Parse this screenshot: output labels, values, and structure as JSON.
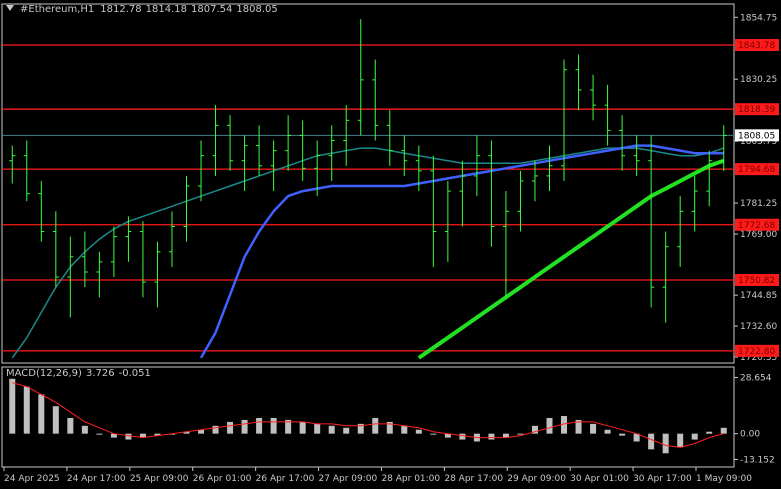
{
  "header": {
    "symbol": "#Ethereum,H1",
    "open": "1812.78",
    "high": "1814.18",
    "low": "1807.54",
    "close": "1808.05"
  },
  "macd_header": {
    "name": "MACD(12,26,9)",
    "main": "3.726",
    "signal": "-0.051"
  },
  "colors": {
    "background": "#000000",
    "grid_frame": "#c8c8c8",
    "candle": "#3cff3c",
    "level_line": "#ff1a1a",
    "level_label_bg": "#ff1a1a",
    "ma_fast": "#1a8a8a",
    "ma_mid": "#4060ff",
    "ma_slow": "#22e022",
    "price_line": "#4a7f8f",
    "histogram": "#c0c0c0",
    "signal_line": "#ff2020"
  },
  "chart_data": [
    {
      "type": "candlestick",
      "title": "#Ethereum,H1",
      "x_ticks": [
        "24 Apr 2025",
        "24 Apr 17:00",
        "25 Apr 09:00",
        "26 Apr 01:00",
        "26 Apr 17:00",
        "27 Apr 09:00",
        "28 Apr 01:00",
        "28 Apr 17:00",
        "29 Apr 09:00",
        "30 Apr 01:00",
        "30 Apr 17:00",
        "1 May 09:00"
      ],
      "y_ticks": [
        "1854.75",
        "1830.25",
        "1805.75",
        "1781.25",
        "1769.00",
        "1744.85",
        "1732.60",
        "1720.35"
      ],
      "ylim": [
        1718,
        1860
      ],
      "current_price": "1808.05",
      "levels": [
        "1843.78",
        "1818.39",
        "1794.68",
        "1772.68",
        "1750.82",
        "1722.80"
      ],
      "candles": [
        [
          1798,
          1804,
          1789,
          1800
        ],
        [
          1800,
          1806,
          1782,
          1785
        ],
        [
          1785,
          1790,
          1766,
          1770
        ],
        [
          1770,
          1778,
          1748,
          1752
        ],
        [
          1752,
          1768,
          1736,
          1760
        ],
        [
          1760,
          1770,
          1748,
          1754
        ],
        [
          1754,
          1762,
          1744,
          1758
        ],
        [
          1758,
          1772,
          1752,
          1768
        ],
        [
          1768,
          1776,
          1758,
          1770
        ],
        [
          1770,
          1774,
          1744,
          1750
        ],
        [
          1750,
          1766,
          1740,
          1762
        ],
        [
          1762,
          1778,
          1756,
          1772
        ],
        [
          1772,
          1792,
          1766,
          1788
        ],
        [
          1788,
          1806,
          1782,
          1800
        ],
        [
          1800,
          1820,
          1792,
          1812
        ],
        [
          1812,
          1816,
          1794,
          1798
        ],
        [
          1798,
          1808,
          1786,
          1804
        ],
        [
          1804,
          1812,
          1792,
          1796
        ],
        [
          1796,
          1806,
          1786,
          1802
        ],
        [
          1802,
          1816,
          1794,
          1808
        ],
        [
          1808,
          1814,
          1790,
          1795
        ],
        [
          1795,
          1806,
          1784,
          1800
        ],
        [
          1800,
          1812,
          1790,
          1806
        ],
        [
          1806,
          1820,
          1796,
          1814
        ],
        [
          1814,
          1854,
          1808,
          1830
        ],
        [
          1830,
          1838,
          1806,
          1812
        ],
        [
          1812,
          1818,
          1796,
          1802
        ],
        [
          1802,
          1808,
          1792,
          1798
        ],
        [
          1798,
          1804,
          1786,
          1794
        ],
        [
          1794,
          1800,
          1756,
          1770
        ],
        [
          1770,
          1790,
          1758,
          1786
        ],
        [
          1786,
          1798,
          1772,
          1792
        ],
        [
          1792,
          1808,
          1784,
          1800
        ],
        [
          1800,
          1806,
          1764,
          1772
        ],
        [
          1772,
          1786,
          1744,
          1778
        ],
        [
          1778,
          1794,
          1770,
          1790
        ],
        [
          1790,
          1798,
          1782,
          1792
        ],
        [
          1792,
          1804,
          1786,
          1796
        ],
        [
          1796,
          1838,
          1790,
          1834
        ],
        [
          1834,
          1840,
          1818,
          1826
        ],
        [
          1826,
          1832,
          1814,
          1820
        ],
        [
          1820,
          1828,
          1804,
          1810
        ],
        [
          1810,
          1816,
          1794,
          1800
        ],
        [
          1800,
          1808,
          1792,
          1798
        ],
        [
          1798,
          1808,
          1740,
          1748
        ],
        [
          1748,
          1770,
          1734,
          1764
        ],
        [
          1764,
          1784,
          1756,
          1778
        ],
        [
          1778,
          1792,
          1770,
          1786
        ],
        [
          1786,
          1802,
          1780,
          1798
        ],
        [
          1798,
          1812,
          1794,
          1808
        ]
      ],
      "ma_fast": [
        1720,
        1728,
        1738,
        1748,
        1756,
        1762,
        1767,
        1771,
        1774,
        1776,
        1778,
        1780,
        1782,
        1784,
        1786,
        1788,
        1790,
        1792,
        1794,
        1796,
        1798,
        1800,
        1801,
        1802,
        1803,
        1803,
        1802,
        1801,
        1800,
        1799,
        1798,
        1797,
        1797,
        1797,
        1797,
        1797,
        1798,
        1799,
        1800,
        1801,
        1802,
        1803,
        1803,
        1803,
        1802,
        1801,
        1800,
        1800,
        1801,
        1803
      ],
      "ma_mid": [
        null,
        null,
        null,
        null,
        null,
        null,
        null,
        null,
        null,
        null,
        null,
        null,
        null,
        1720,
        1730,
        1745,
        1760,
        1770,
        1778,
        1784,
        1786,
        1787,
        1788,
        1788,
        1788,
        1788,
        1788,
        1788,
        1789,
        1790,
        1791,
        1792,
        1793,
        1794,
        1795,
        1796,
        1797,
        1798,
        1799,
        1800,
        1801,
        1802,
        1803,
        1804,
        1804,
        1803,
        1802,
        1801,
        1801,
        1801
      ],
      "ma_slow": [
        null,
        null,
        null,
        null,
        null,
        null,
        null,
        null,
        null,
        null,
        null,
        null,
        null,
        null,
        null,
        null,
        null,
        null,
        null,
        null,
        null,
        null,
        null,
        null,
        null,
        null,
        null,
        null,
        1720,
        1724,
        1728,
        1732,
        1736,
        1740,
        1744,
        1748,
        1752,
        1756,
        1760,
        1764,
        1768,
        1772,
        1776,
        1780,
        1784,
        1787,
        1790,
        1793,
        1796,
        1798
      ]
    },
    {
      "type": "bar",
      "title": "MACD(12,26,9)",
      "y_ticks": [
        "28.654",
        "0.00",
        "-13.152"
      ],
      "ylim": [
        -17,
        34
      ],
      "histogram": [
        28,
        24,
        20,
        14,
        8,
        4,
        0,
        -2,
        -3,
        -2,
        -1,
        0,
        1,
        2,
        4,
        6,
        7,
        8,
        8,
        7,
        6,
        5,
        4,
        3,
        5,
        8,
        6,
        4,
        2,
        0,
        -2,
        -3,
        -4,
        -3,
        -2,
        0,
        4,
        8,
        9,
        7,
        5,
        2,
        -1,
        -4,
        -8,
        -10,
        -7,
        -3,
        1,
        3
      ],
      "signal": [
        26,
        24,
        20,
        16,
        11,
        6,
        3,
        0,
        -1,
        -2,
        -1,
        0,
        1,
        2,
        3,
        4,
        5,
        6,
        6,
        6,
        6,
        5,
        5,
        4,
        4,
        5,
        5,
        4,
        3,
        1,
        0,
        -1,
        -2,
        -2,
        -2,
        -1,
        1,
        3,
        5,
        6,
        6,
        4,
        2,
        0,
        -3,
        -6,
        -7,
        -5,
        -2,
        0
      ]
    }
  ]
}
